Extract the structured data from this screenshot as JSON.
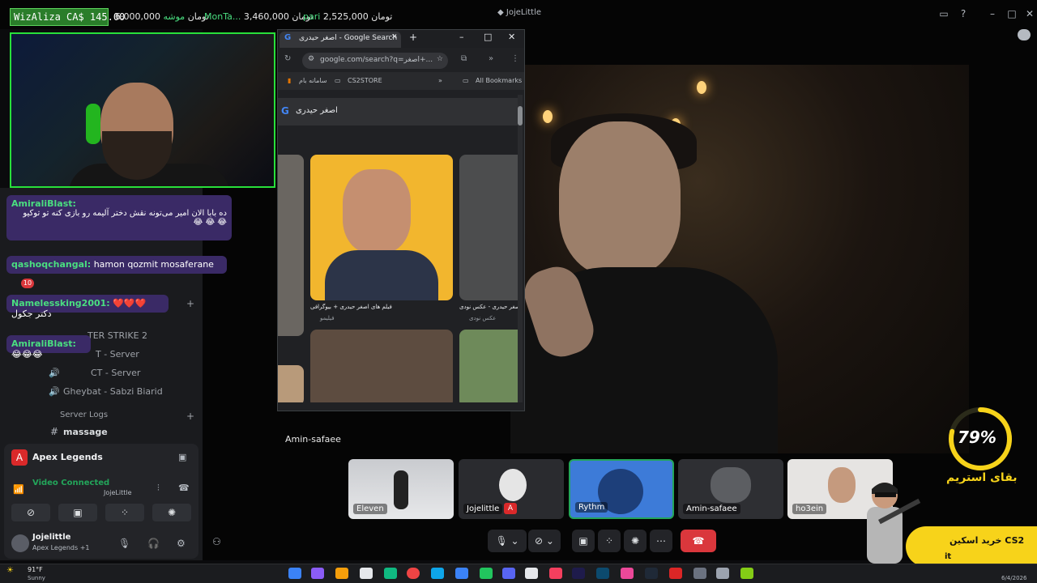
{
  "ticker": {
    "wiz": "WizAliza CA$ 145.00",
    "items": [
      {
        "name": "موشه",
        "text": "6,000,000 تومان"
      },
      {
        "name": "MonTa...",
        "text": "3,460,000 تومان"
      },
      {
        "name": "pari",
        "text": "2,525,000 تومان"
      }
    ]
  },
  "window": {
    "title": "JojeLittle"
  },
  "chat": [
    {
      "user": "AmiraliBlast:",
      "text": "ده بابا الان امیر می‌تونه نقش دختر آلیمه رو بازی کنه تو توکیو 😂 😂 😂"
    },
    {
      "user": "qashoqchangal:",
      "text": "hamon qozmit mosaferane"
    },
    {
      "user": "Namelessking2001:",
      "text": "❤️❤️❤️ دکتر جکول"
    },
    {
      "user": "AmiraliBlast:",
      "text": "😂😂😂"
    }
  ],
  "discord": {
    "channels": [
      {
        "label": "TER STRIKE 2"
      },
      {
        "label": "T - Server"
      },
      {
        "label": "CT - Server"
      },
      {
        "label": "Gheybat - Sabzi Biarid"
      },
      {
        "label": "Server Logs"
      },
      {
        "label": "massage"
      }
    ],
    "badge": "10",
    "game": "Apex Legends",
    "voice_status": "Video Connected",
    "voice_sub": "JojeLittle",
    "user_name": "Jojelittle",
    "user_status": "Apex Legends +1"
  },
  "chrome": {
    "tab_title": "اصغر حیدری - Google Search",
    "url": "google.com/search?q=اصغر+...",
    "bookmarks": [
      "سامانه بام",
      "CS2STORE",
      "All Bookmarks"
    ],
    "search_query": "اصغر حیدری",
    "results": [
      {
        "title": "فیلم های اصغر حیدری + بیوگرافی",
        "source": "فیلیمو"
      },
      {
        "title": "اصغر حیدری - عکس نودی",
        "source": "عکس نودی"
      }
    ]
  },
  "stage": {
    "speaker_label": "Amin-safaee"
  },
  "participants": [
    {
      "name": "Eleven"
    },
    {
      "name": "Jojelittle"
    },
    {
      "name": "Rythm"
    },
    {
      "name": "Amin-safaee"
    },
    {
      "name": "ho3ein"
    }
  ],
  "overlay": {
    "percent": "79%",
    "percent_value": 0.79,
    "remaining_label": "بقای استریم",
    "promo": "خرید اسکین CS2",
    "promo_sub": "it"
  },
  "taskbar": {
    "weather_temp": "91°F",
    "weather_desc": "Sunny",
    "date": "6/4/2026"
  },
  "colors": {
    "accent_green": "#28e03a",
    "discord_blue": "#3d7bd8",
    "hangup_red": "#da373c",
    "promo_yellow": "#f7d31a"
  }
}
